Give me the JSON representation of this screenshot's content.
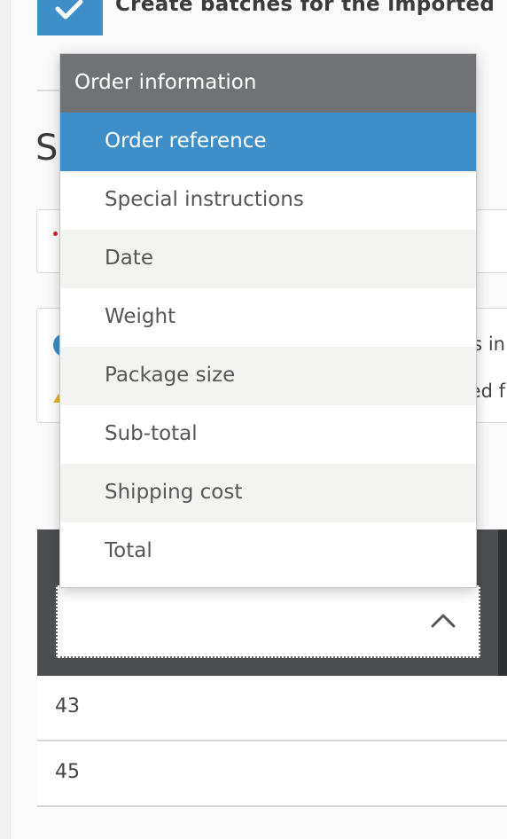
{
  "import_options": {
    "create_batches_label": "Create batches for the imported",
    "create_batches_checked": true
  },
  "section": {
    "heading_fragment": "S"
  },
  "notice_card": {
    "text_fragment_1": "s in",
    "text_fragment_2": "ed f"
  },
  "dropdown": {
    "group_label": "Order information",
    "options": [
      {
        "label": "Order reference",
        "selected": true
      },
      {
        "label": "Special instructions",
        "selected": false
      },
      {
        "label": "Date",
        "selected": false
      },
      {
        "label": "Weight",
        "selected": false
      },
      {
        "label": "Package size",
        "selected": false
      },
      {
        "label": "Sub-total",
        "selected": false
      },
      {
        "label": "Shipping cost",
        "selected": false
      },
      {
        "label": "Total",
        "selected": false
      }
    ]
  },
  "column_select": {
    "value": "",
    "icon": "chevron-up-icon"
  },
  "table": {
    "rows": [
      {
        "value": "43"
      },
      {
        "value": "45"
      }
    ]
  },
  "colors": {
    "accent": "#3d8ec9",
    "group_header": "#707275",
    "table_header": "#4d4e51"
  }
}
